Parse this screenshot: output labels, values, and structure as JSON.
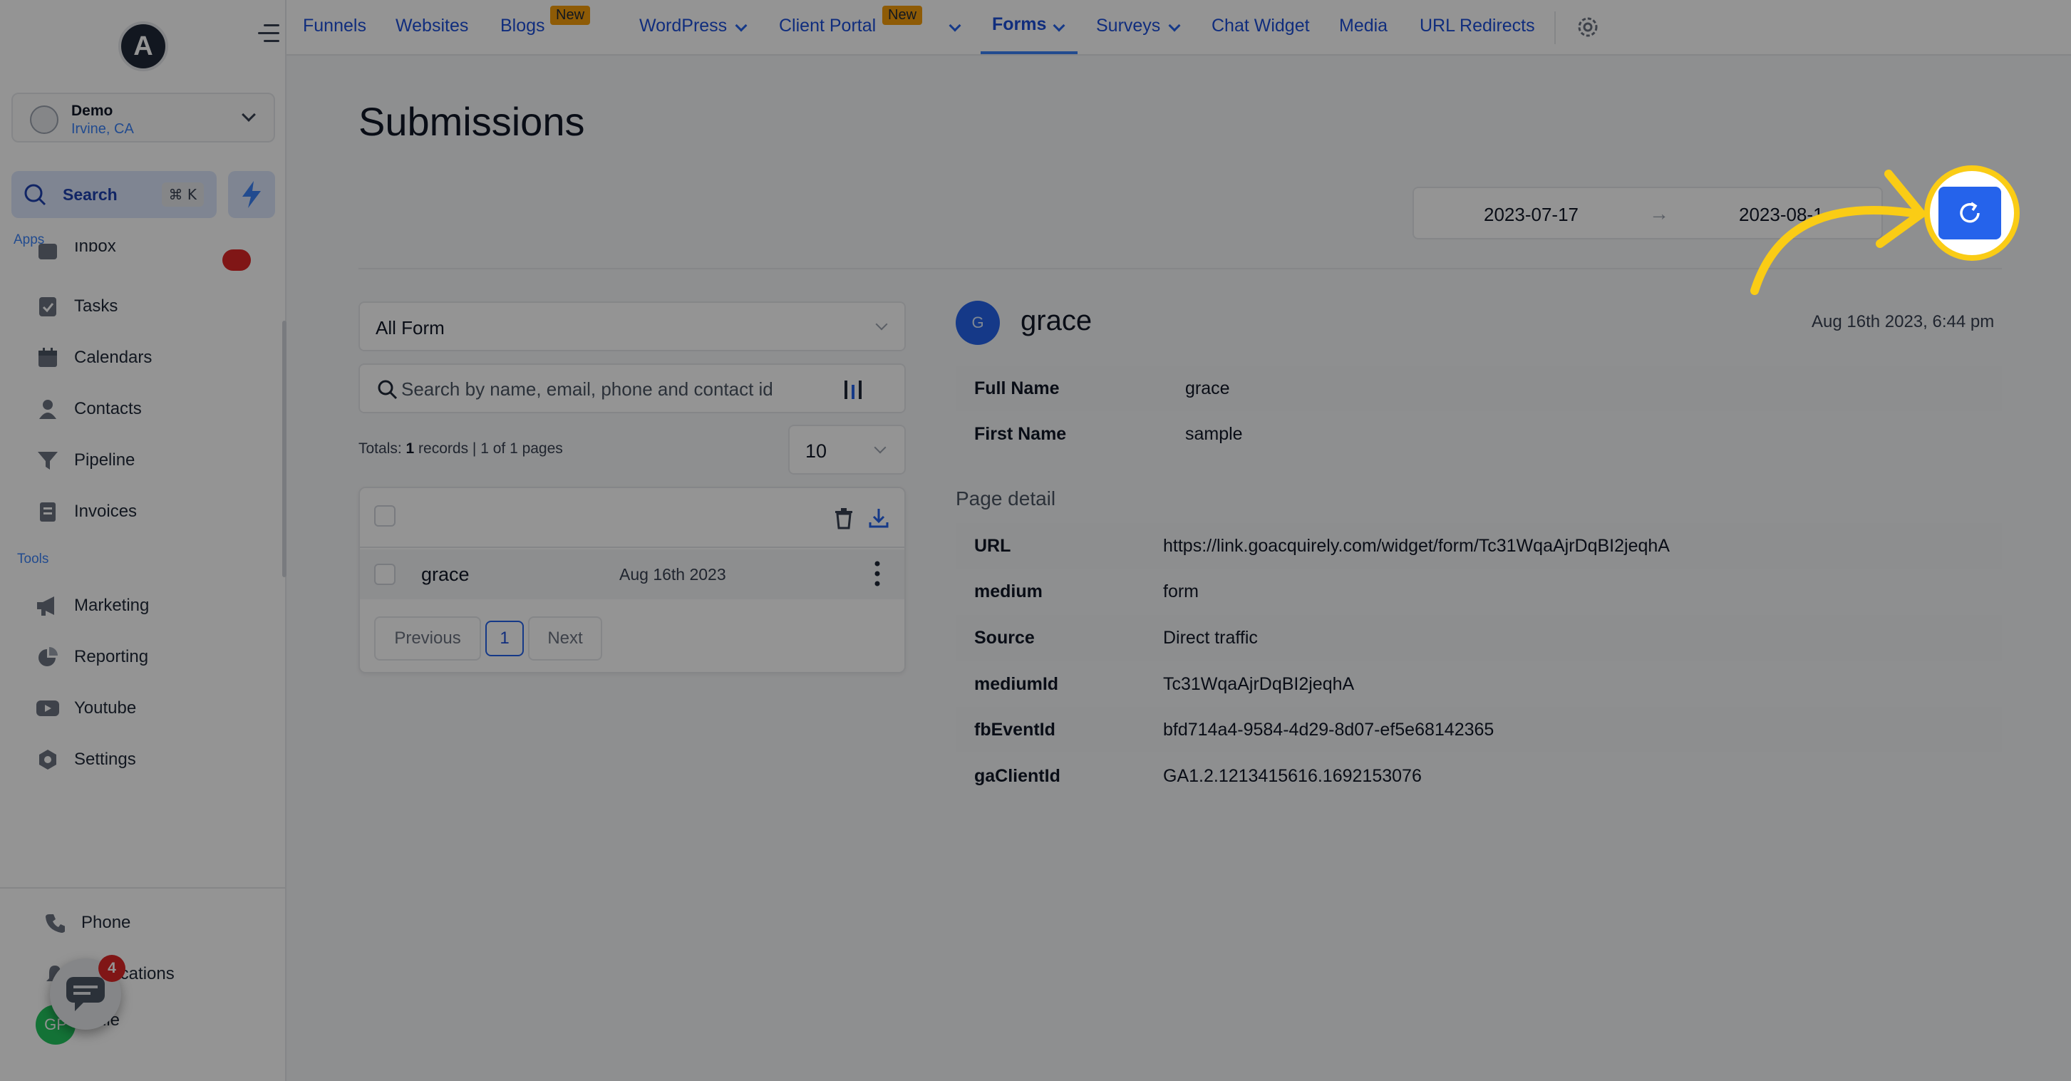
{
  "sidebar": {
    "location": {
      "name": "Demo",
      "city": "Irvine, CA"
    },
    "search": {
      "label": "Search",
      "shortcut": "⌘ K"
    },
    "apps_label": "Apps",
    "tools_label": "Tools",
    "apps": [
      {
        "label": "Inbox",
        "icon": "inbox-icon"
      },
      {
        "label": "Tasks",
        "icon": "tasks-icon"
      },
      {
        "label": "Calendars",
        "icon": "calendar-icon"
      },
      {
        "label": "Contacts",
        "icon": "contacts-icon"
      },
      {
        "label": "Pipeline",
        "icon": "funnel-icon"
      },
      {
        "label": "Invoices",
        "icon": "invoice-icon"
      }
    ],
    "tools": [
      {
        "label": "Marketing",
        "icon": "megaphone-icon"
      },
      {
        "label": "Reporting",
        "icon": "pie-chart-icon"
      },
      {
        "label": "Youtube",
        "icon": "youtube-icon"
      },
      {
        "label": "Settings",
        "icon": "gear-icon"
      }
    ],
    "bottom": [
      {
        "label": "Phone",
        "icon": "phone-icon"
      },
      {
        "label": "Notifications",
        "icon": "bell-icon"
      },
      {
        "label": "Profile",
        "icon": "avatar"
      }
    ],
    "chat_badge": "4",
    "profile_initials": "GP"
  },
  "topnav": {
    "items": [
      {
        "label": "Funnels"
      },
      {
        "label": "Websites"
      },
      {
        "label": "Blogs",
        "badge": "New"
      },
      {
        "label": "WordPress"
      },
      {
        "label": "Client Portal",
        "badge": "New"
      },
      {
        "label": "Forms",
        "active": true
      },
      {
        "label": "Surveys"
      },
      {
        "label": "Chat Widget"
      },
      {
        "label": "Media"
      },
      {
        "label": "URL Redirects"
      }
    ]
  },
  "page": {
    "title": "Submissions",
    "date_start": "2023-07-17",
    "date_end": "2023-08-1",
    "date_arrow": "→"
  },
  "list": {
    "form_filter": "All Form",
    "search_placeholder": "Search by name, email, phone and contact id",
    "totals_prefix": "Totals: ",
    "totals_count": "1",
    "totals_suffix": " records | 1 of 1 pages",
    "per_page": "10",
    "rows": [
      {
        "name": "grace",
        "date": "Aug 16th 2023"
      }
    ],
    "pager": {
      "previous": "Previous",
      "current": "1",
      "next": "Next"
    }
  },
  "detail": {
    "avatar_initial": "G",
    "name": "grace",
    "submitted_at": "Aug 16th 2023, 6:44 pm",
    "fields": [
      {
        "key": "Full Name",
        "value": "grace"
      },
      {
        "key": "First Name",
        "value": "sample"
      }
    ],
    "page_detail_label": "Page detail",
    "page_detail": [
      {
        "key": "URL",
        "value": "https://link.goacquirely.com/widget/form/Tc31WqaAjrDqBI2jeqhA"
      },
      {
        "key": "medium",
        "value": "form"
      },
      {
        "key": "Source",
        "value": "Direct traffic"
      },
      {
        "key": "mediumId",
        "value": "Tc31WqaAjrDqBI2jeqhA"
      },
      {
        "key": "fbEventId",
        "value": "bfd714a4-9584-4d29-8d07-ef5e68142365"
      },
      {
        "key": "gaClientId",
        "value": "GA1.2.1213415616.1692153076"
      }
    ]
  },
  "colors": {
    "accent": "#2563eb",
    "highlight": "#facc15",
    "badge_red": "#dc2626",
    "new_badge": "#f59e0b"
  }
}
